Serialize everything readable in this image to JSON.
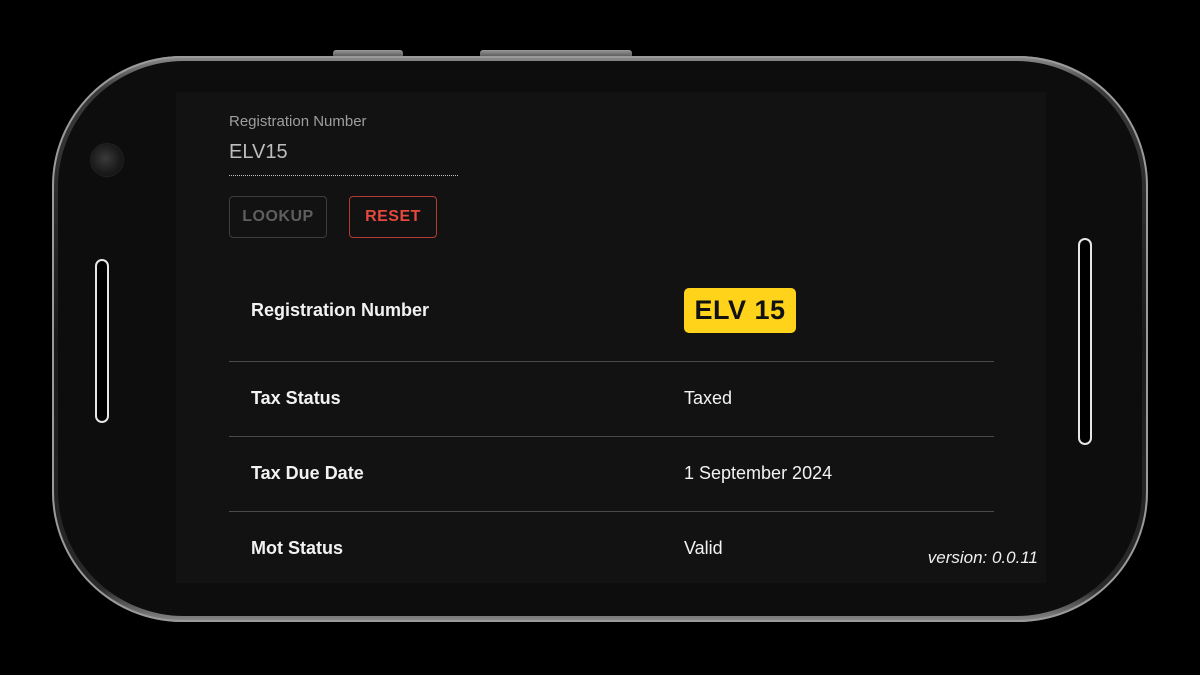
{
  "form": {
    "label": "Registration Number",
    "value": "ELV15"
  },
  "buttons": {
    "lookup_label": "LOOKUP",
    "reset_label": "RESET"
  },
  "results": [
    {
      "label": "Registration Number",
      "value": "ELV 15"
    },
    {
      "label": "Tax Status",
      "value": "Taxed"
    },
    {
      "label": "Tax Due Date",
      "value": "1 September 2024"
    },
    {
      "label": "Mot Status",
      "value": "Valid"
    }
  ],
  "footer": {
    "version": "version: 0.0.11"
  },
  "colors": {
    "plate_background": "#ffd31a",
    "reset_accent": "#e5483e",
    "screen_background": "#121212"
  }
}
